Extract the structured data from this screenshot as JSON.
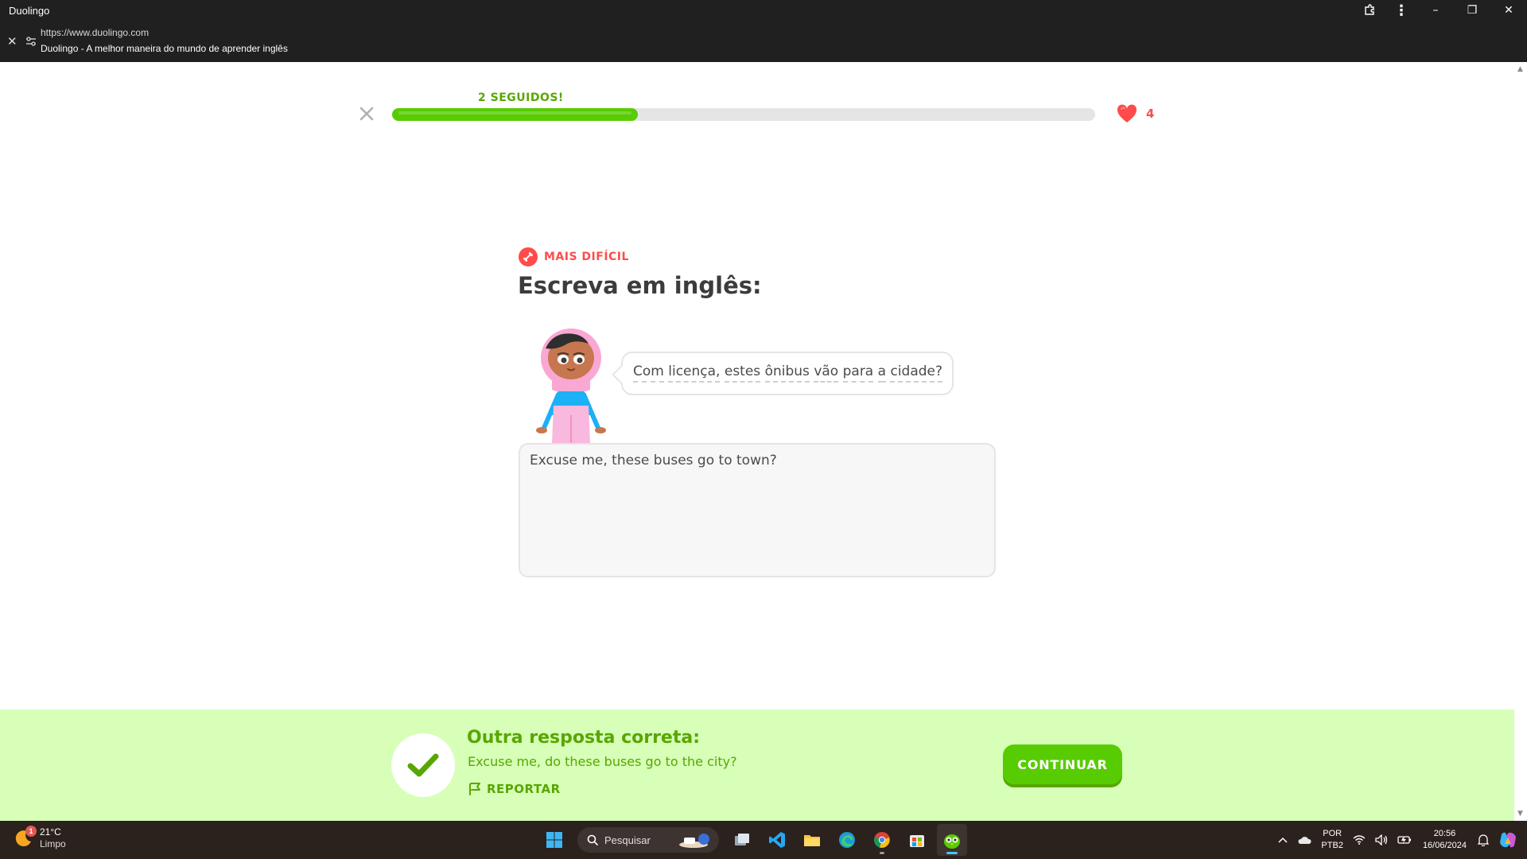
{
  "window": {
    "app_title": "Duolingo",
    "url": "https://www.duolingo.com",
    "page_title": "Duolingo - A melhor maneira do mundo de aprender inglês",
    "controls": {
      "minimize": "–",
      "restore": "❐",
      "close": "✕"
    }
  },
  "lesson": {
    "progress_percent": 35,
    "streak_label": "2 SEGUIDOS!",
    "hearts": "4",
    "colors": {
      "green": "#58cc02",
      "dark_green": "#58a700",
      "red": "#ff4b4b"
    }
  },
  "challenge": {
    "badge_label": "MAIS DIFÍCIL",
    "title": "Escreva em inglês:",
    "prompt_words": [
      "Com",
      "licença,",
      "estes",
      "ônibus",
      "vão",
      "para",
      "a",
      "cidade?"
    ],
    "answer_value": "Excuse me, these buses go to town?"
  },
  "feedback": {
    "title": "Outra resposta correta:",
    "answer": "Excuse me, do these buses go to the city?",
    "report_label": "REPORTAR",
    "continue_label": "CONTINUAR",
    "background": "#d7ffb8"
  },
  "taskbar": {
    "weather_badge": "1",
    "weather_temp": "21°C",
    "weather_desc": "Limpo",
    "search_placeholder": "Pesquisar",
    "apps": [
      "windows-start-icon",
      "task-view-icon",
      "vscode-icon",
      "file-explorer-icon",
      "edge-icon",
      "chrome-icon",
      "microsoft-store-icon",
      "duolingo-app-icon"
    ],
    "lang_line1": "POR",
    "lang_line2": "PTB2",
    "time": "20:56",
    "date": "16/06/2024"
  }
}
